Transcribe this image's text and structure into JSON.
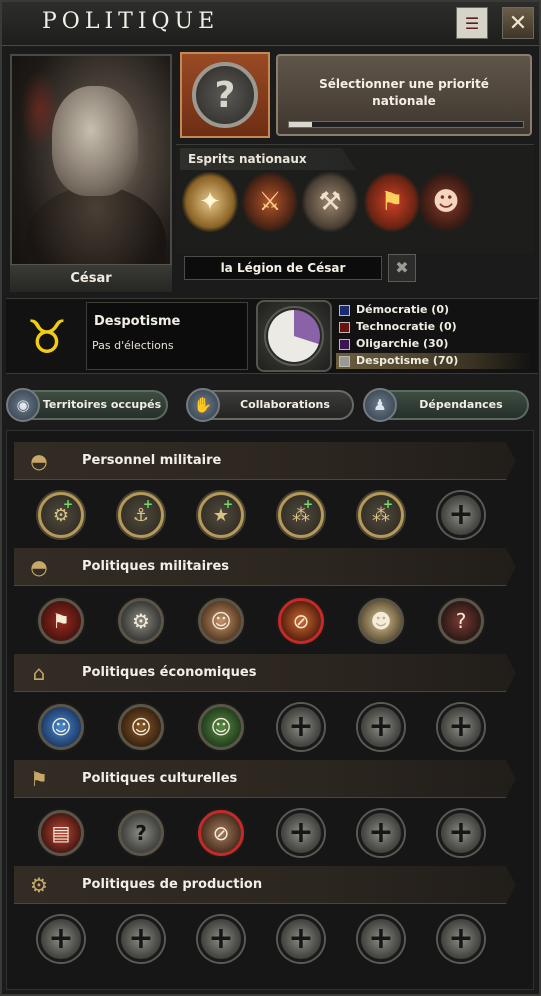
{
  "window": {
    "title": "Politique",
    "ledger_icon": "ledger-icon",
    "close_label": "✕"
  },
  "leader": {
    "name": "César"
  },
  "focus": {
    "icon": "question-mark-laurel-icon",
    "button_label": "Sélectionner une priorité nationale",
    "progress": 0.1
  },
  "spirits": {
    "label": "Esprits nationaux",
    "items": [
      {
        "name": "compass-laurel-icon",
        "glyph": "✦"
      },
      {
        "name": "armored-warrior-icon",
        "glyph": "⚔"
      },
      {
        "name": "workshop-icon",
        "glyph": "⚒"
      },
      {
        "name": "legion-banner-icon",
        "glyph": "⚑"
      },
      {
        "name": "soldier-portrait-icon",
        "glyph": "☻"
      }
    ]
  },
  "faction": {
    "name": "la Légion de César",
    "button_icon": "faction-arrows-icon"
  },
  "government": {
    "ideology": "Despotisme",
    "election": "Pas d'élections",
    "icon": "golden-bull-icon"
  },
  "popularity": {
    "items": [
      {
        "label": "Démocratie (0)",
        "value": 0,
        "color": "#1a2a6c"
      },
      {
        "label": "Technocratie (0)",
        "value": 0,
        "color": "#6a1212"
      },
      {
        "label": "Oligarchie (30)",
        "value": 30,
        "color": "#3c1450"
      },
      {
        "label": "Despotisme (70)",
        "value": 70,
        "color": "#9a9a94"
      }
    ],
    "pie_colors": {
      "Despotisme": "#eceae4",
      "Oligarchie": "#8a62a8"
    }
  },
  "tabs": [
    {
      "label": "Territoires occupés",
      "icon": "globe-icon"
    },
    {
      "label": "Collaborations",
      "icon": "handshake-icon"
    },
    {
      "label": "Dépendances",
      "icon": "pawn-icon"
    }
  ],
  "sections": [
    {
      "title": "Personnel militaire",
      "icon": "helmet-icon",
      "slots": [
        {
          "type": "star",
          "glyph": "⚙",
          "name": "army-chief-slot"
        },
        {
          "type": "star",
          "glyph": "⚓",
          "name": "navy-chief-slot"
        },
        {
          "type": "star",
          "glyph": "★",
          "name": "air-chief-slot"
        },
        {
          "type": "star",
          "glyph": "⁂",
          "name": "high-command-slot-1"
        },
        {
          "type": "star",
          "glyph": "⁂",
          "name": "high-command-slot-2"
        },
        {
          "type": "empty",
          "glyph": "+",
          "name": "add-slot"
        }
      ]
    },
    {
      "title": "Politiques militaires",
      "icon": "helmet-icon",
      "slots": [
        {
          "type": "filled",
          "style": "f-flag",
          "glyph": "⚑",
          "name": "torn-banner-policy"
        },
        {
          "type": "filled",
          "style": "f-robot",
          "glyph": "⚙",
          "name": "robot-policy"
        },
        {
          "type": "filled",
          "style": "f-man",
          "glyph": "☺",
          "name": "slave-policy"
        },
        {
          "type": "filled",
          "style": "f-ban",
          "glyph": "⊘",
          "name": "banned-fire-policy"
        },
        {
          "type": "filled",
          "style": "f-soldier",
          "glyph": "☻",
          "name": "soldier-policy"
        },
        {
          "type": "filled",
          "style": "f-question",
          "glyph": "?",
          "name": "unknown-soldier-policy"
        }
      ]
    },
    {
      "title": "Politiques économiques",
      "icon": "bank-icon",
      "slots": [
        {
          "type": "filled",
          "style": "f-blue",
          "glyph": "☺",
          "name": "vault-boy-policy-1"
        },
        {
          "type": "filled",
          "style": "f-brown",
          "glyph": "☺",
          "name": "vault-boy-policy-2"
        },
        {
          "type": "filled",
          "style": "f-green",
          "glyph": "☺",
          "name": "vault-boy-policy-3"
        },
        {
          "type": "empty",
          "glyph": "+",
          "name": "add-slot"
        },
        {
          "type": "empty",
          "glyph": "+",
          "name": "add-slot"
        },
        {
          "type": "empty",
          "glyph": "+",
          "name": "add-slot"
        }
      ]
    },
    {
      "title": "Politiques culturelles",
      "icon": "flag-icon",
      "slots": [
        {
          "type": "filled",
          "style": "f-book",
          "glyph": "▤",
          "name": "magazine-policy"
        },
        {
          "type": "filled",
          "style": "f-q2",
          "glyph": "?",
          "name": "unknown-policy"
        },
        {
          "type": "filled",
          "style": "f-noalc",
          "glyph": "⊘",
          "name": "prohibition-policy"
        },
        {
          "type": "empty",
          "glyph": "+",
          "name": "add-slot"
        },
        {
          "type": "empty",
          "glyph": "+",
          "name": "add-slot"
        },
        {
          "type": "empty",
          "glyph": "+",
          "name": "add-slot"
        }
      ]
    },
    {
      "title": "Politiques de production",
      "icon": "gears-icon",
      "slots": [
        {
          "type": "empty",
          "glyph": "+",
          "name": "add-slot"
        },
        {
          "type": "empty",
          "glyph": "+",
          "name": "add-slot"
        },
        {
          "type": "empty",
          "glyph": "+",
          "name": "add-slot"
        },
        {
          "type": "empty",
          "glyph": "+",
          "name": "add-slot"
        },
        {
          "type": "empty",
          "glyph": "+",
          "name": "add-slot"
        },
        {
          "type": "empty",
          "glyph": "+",
          "name": "add-slot"
        }
      ]
    }
  ]
}
